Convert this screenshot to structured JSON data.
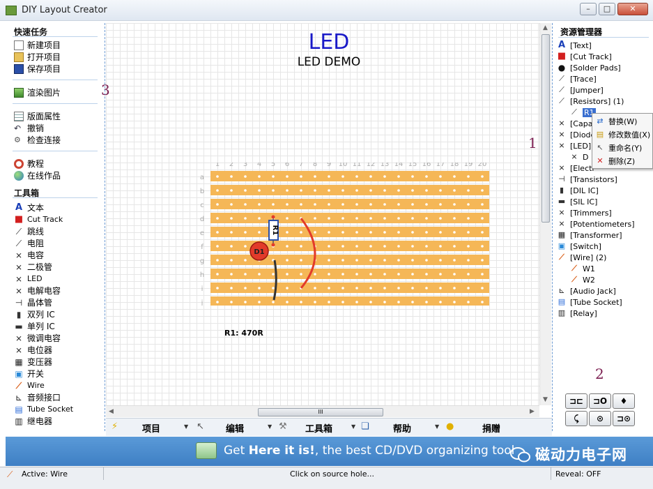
{
  "window": {
    "title": "DIY Layout Creator",
    "controls": {
      "minimize": "–",
      "maximize": "□",
      "close": "✕"
    }
  },
  "left_panel": {
    "quick_tasks_header": "快速任务",
    "quick_tasks": [
      {
        "label": "新建项目",
        "icon": "new-file-icon"
      },
      {
        "label": "打开项目",
        "icon": "open-folder-icon"
      },
      {
        "label": "保存项目",
        "icon": "save-disk-icon"
      }
    ],
    "render": {
      "label": "渲染图片",
      "icon": "image-icon"
    },
    "edit_tasks": [
      {
        "label": "版面属性",
        "icon": "properties-icon"
      },
      {
        "label": "撤销",
        "icon": "undo-icon"
      },
      {
        "label": "检查连接",
        "icon": "check-connections-icon"
      }
    ],
    "help_tasks": [
      {
        "label": "教程",
        "icon": "tutorial-icon"
      },
      {
        "label": "在线作品",
        "icon": "globe-icon"
      }
    ],
    "toolbox_header": "工具箱",
    "toolbox": [
      {
        "label": "文本",
        "icon": "text-icon"
      },
      {
        "label": "Cut Track",
        "icon": "cut-track-icon"
      },
      {
        "label": "跳线",
        "icon": "jumper-icon"
      },
      {
        "label": "电阻",
        "icon": "resistor-icon"
      },
      {
        "label": "电容",
        "icon": "capacitor-icon"
      },
      {
        "label": "二极管",
        "icon": "diode-icon"
      },
      {
        "label": "LED",
        "icon": "led-icon"
      },
      {
        "label": "电解电容",
        "icon": "electrolytic-icon"
      },
      {
        "label": "晶体管",
        "icon": "transistor-icon"
      },
      {
        "label": "双列 IC",
        "icon": "dil-ic-icon"
      },
      {
        "label": "单列 IC",
        "icon": "sil-ic-icon"
      },
      {
        "label": "微调电容",
        "icon": "trimmer-icon"
      },
      {
        "label": "电位器",
        "icon": "potentiometer-icon"
      },
      {
        "label": "变压器",
        "icon": "transformer-icon"
      },
      {
        "label": "开关",
        "icon": "switch-icon"
      },
      {
        "label": "Wire",
        "icon": "wire-icon"
      },
      {
        "label": "音频接口",
        "icon": "audio-jack-icon"
      },
      {
        "label": "Tube Socket",
        "icon": "tube-socket-icon"
      },
      {
        "label": "继电器",
        "icon": "relay-icon"
      }
    ]
  },
  "canvas": {
    "title": "LED",
    "subtitle": "LED DEMO",
    "columns": [
      "1",
      "2",
      "3",
      "4",
      "5",
      "6",
      "7",
      "8",
      "9",
      "10",
      "11",
      "12",
      "13",
      "14",
      "15",
      "16",
      "17",
      "18",
      "19",
      "20"
    ],
    "rows": [
      "a",
      "b",
      "c",
      "d",
      "e",
      "f",
      "g",
      "h",
      "i",
      "j"
    ],
    "resistor_label": "R1",
    "led_label": "D1",
    "bom": "R1: 470R",
    "colors": {
      "strip": "#f5b757",
      "hole": "#ffffff",
      "led": "#e23b2a",
      "wire_red": "#e23b2a",
      "wire_black": "#333333",
      "title": "#1a1ac8"
    }
  },
  "menu": [
    {
      "label": "项目",
      "icon": "lightning-icon"
    },
    {
      "label": "编辑",
      "icon": "cursor-icon"
    },
    {
      "label": "工具箱",
      "icon": "hammer-icon"
    },
    {
      "label": "帮助",
      "icon": "book-icon"
    },
    {
      "label": "捐赠",
      "icon": "coin-icon"
    }
  ],
  "hscroll_grip": "III",
  "right_panel": {
    "header": "资源管理器",
    "items": [
      {
        "label": "[Text]",
        "icon": "text-icon"
      },
      {
        "label": "[Cut Track]",
        "icon": "cut-track-icon"
      },
      {
        "label": "[Solder Pads]",
        "icon": "solder-pads-icon"
      },
      {
        "label": "[Trace]",
        "icon": "trace-icon"
      },
      {
        "label": "[Jumper]",
        "icon": "jumper-icon"
      },
      {
        "label": "[Resistors] (1)",
        "icon": "resistor-icon"
      },
      {
        "label": "R1",
        "icon": "resistor-icon"
      },
      {
        "label": "[Capa",
        "icon": "capacitor-icon"
      },
      {
        "label": "[Diode",
        "icon": "diode-icon"
      },
      {
        "label": "[LED]",
        "icon": "led-icon"
      },
      {
        "label": "D",
        "icon": "led-icon"
      },
      {
        "label": "[Electr",
        "icon": "electrolytic-icon"
      },
      {
        "label": "[Transistors]",
        "icon": "transistor-icon"
      },
      {
        "label": "[DIL IC]",
        "icon": "dil-ic-icon"
      },
      {
        "label": "[SIL IC]",
        "icon": "sil-ic-icon"
      },
      {
        "label": "[Trimmers]",
        "icon": "trimmer-icon"
      },
      {
        "label": "[Potentiometers]",
        "icon": "potentiometer-icon"
      },
      {
        "label": "[Transformer]",
        "icon": "transformer-icon"
      },
      {
        "label": "[Switch]",
        "icon": "switch-icon"
      },
      {
        "label": "[Wire] (2)",
        "icon": "wire-icon"
      },
      {
        "label": "W1",
        "icon": "wire-icon"
      },
      {
        "label": "W2",
        "icon": "wire-icon"
      },
      {
        "label": "[Audio Jack]",
        "icon": "audio-jack-icon"
      },
      {
        "label": "[Tube Socket]",
        "icon": "tube-socket-icon"
      },
      {
        "label": "[Relay]",
        "icon": "relay-icon"
      }
    ]
  },
  "context_menu": [
    {
      "label": "替换(W)",
      "icon": "replace-icon"
    },
    {
      "label": "修改数值(X)",
      "icon": "edit-values-icon"
    },
    {
      "label": "重命名(Y)",
      "icon": "cursor-icon"
    },
    {
      "label": "删除(Z)",
      "icon": "delete-x-icon"
    }
  ],
  "tool_buttons": [
    "⊐⊏",
    "⊐O",
    "♦",
    "⤹",
    "⊙",
    "⊐⊙"
  ],
  "annotations": {
    "a1": "1",
    "a2": "2",
    "a3": "3"
  },
  "banner": {
    "text_prefix": "Get",
    "text_bold": "Here it is!",
    "text_suffix": ", the best CD/DVD organizing tool",
    "watermark": "磁动力电子网"
  },
  "status": {
    "active": "Active: Wire",
    "message": "Click on source hole...",
    "reveal": "Reveal: OFF"
  }
}
